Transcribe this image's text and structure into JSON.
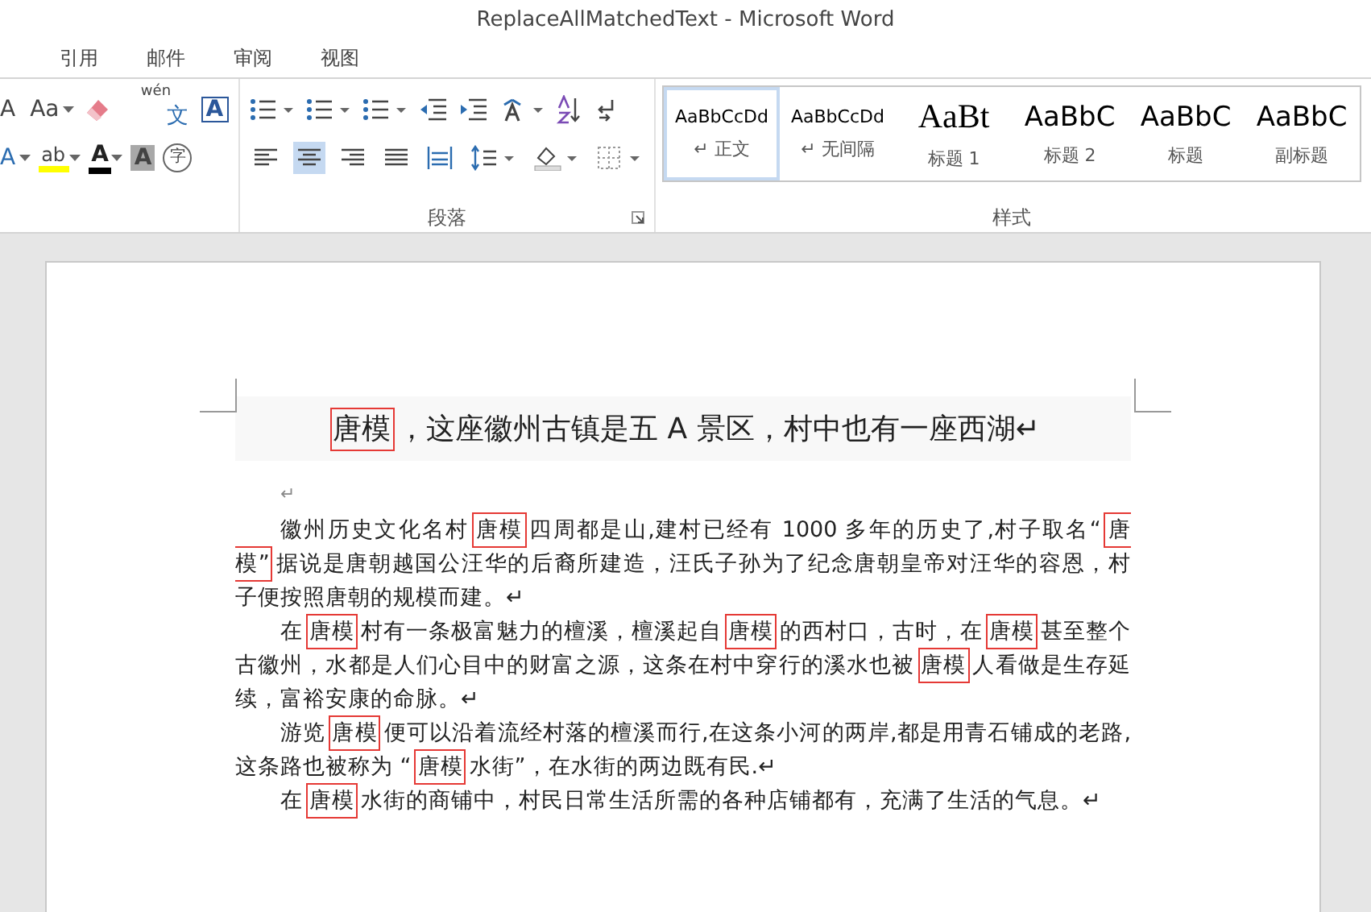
{
  "window": {
    "title": "ReplaceAllMatchedText - Microsoft Word"
  },
  "tabs": [
    {
      "label": "引用",
      "selected": false
    },
    {
      "label": "邮件",
      "selected": false
    },
    {
      "label": "审阅",
      "selected": false
    },
    {
      "label": "视图",
      "selected": false
    }
  ],
  "font_group": {
    "row1": [
      {
        "kind": "grow",
        "glyph": "A"
      },
      {
        "kind": "case",
        "glyph": "Aa"
      },
      {
        "kind": "clear"
      },
      {
        "kind": "phonetic",
        "glyph": "wén",
        "sub": "文"
      },
      {
        "kind": "border",
        "glyph": "A"
      }
    ],
    "row2": [
      {
        "kind": "effects",
        "glyph": "A"
      },
      {
        "kind": "highlight",
        "glyph": "ab"
      },
      {
        "kind": "color",
        "glyph": "A"
      },
      {
        "kind": "shading",
        "glyph": "A"
      },
      {
        "kind": "enclose",
        "glyph": "字"
      }
    ]
  },
  "paragraph_group": {
    "label": "段落",
    "row1": [
      {
        "kind": "bullets"
      },
      {
        "kind": "numbering"
      },
      {
        "kind": "multilevel"
      },
      {
        "kind": "outdent"
      },
      {
        "kind": "indent"
      },
      {
        "kind": "direction"
      },
      {
        "kind": "sort"
      },
      {
        "kind": "marks"
      }
    ],
    "row2": [
      {
        "kind": "left",
        "selected": false
      },
      {
        "kind": "center",
        "selected": true
      },
      {
        "kind": "right",
        "selected": false
      },
      {
        "kind": "justify",
        "selected": false
      },
      {
        "kind": "distribute",
        "selected": false
      },
      {
        "kind": "spacing",
        "selected": false
      },
      {
        "kind": "fill",
        "selected": false
      },
      {
        "kind": "borders",
        "selected": false
      }
    ]
  },
  "styles_group": {
    "label": "样式",
    "styles": [
      {
        "kind": "normal",
        "sample": "AaBbCcDd",
        "name": "↵ 正文",
        "selected": true
      },
      {
        "kind": "normal",
        "sample": "AaBbCcDd",
        "name": "↵ 无间隔",
        "selected": false
      },
      {
        "kind": "heading1",
        "sample": "AaBt",
        "name": "标题 1",
        "selected": false
      },
      {
        "kind": "heading",
        "sample": "AaBbC",
        "name": "标题 2",
        "selected": false
      },
      {
        "kind": "heading",
        "sample": "AaBbC",
        "name": "标题",
        "selected": false
      },
      {
        "kind": "heading",
        "sample": "AaBbC",
        "name": "副标题",
        "selected": false
      }
    ]
  },
  "document": {
    "paragraphs": [
      {
        "kind": "heading",
        "segments": [
          {
            "text": "唐模",
            "boxed": true
          },
          {
            "text": "，这座徽州古镇是五 A 景区，村中也有一座西湖↵",
            "boxed": false
          }
        ]
      },
      {
        "kind": "empty",
        "segments": [
          {
            "text": "↵",
            "boxed": false
          }
        ]
      },
      {
        "kind": "body",
        "segments": [
          {
            "text": "徽州历史文化名村",
            "boxed": false
          },
          {
            "text": "唐模",
            "boxed": true
          },
          {
            "text": "四周都是山,建村已经有 1000 多年的历史了,村子取名“",
            "boxed": false
          },
          {
            "text": "唐模”",
            "boxed": true
          },
          {
            "text": "据说是唐朝越国公汪华的后裔所建造，汪氏子孙为了纪念唐朝皇帝对汪华的容恩，村子便按照唐朝的规模而建。↵",
            "boxed": false
          }
        ]
      },
      {
        "kind": "body",
        "segments": [
          {
            "text": "在",
            "boxed": false
          },
          {
            "text": "唐模",
            "boxed": true
          },
          {
            "text": "村有一条极富魅力的檀溪，檀溪起自",
            "boxed": false
          },
          {
            "text": "唐模",
            "boxed": true
          },
          {
            "text": "的西村口，古时，在",
            "boxed": false
          },
          {
            "text": "唐模",
            "boxed": true
          },
          {
            "text": "甚至整个古徽州，水都是人们心目中的财富之源，这条在村中穿行的溪水也被",
            "boxed": false
          },
          {
            "text": "唐模",
            "boxed": true
          },
          {
            "text": "人看做是生存延续，富裕安康的命脉。↵",
            "boxed": false
          }
        ]
      },
      {
        "kind": "body",
        "segments": [
          {
            "text": "游览",
            "boxed": false
          },
          {
            "text": "唐模",
            "boxed": true
          },
          {
            "text": "便可以沿着流经村落的檀溪而行,在这条小河的两岸,都是用青石铺成的老路,这条路也被称为 “",
            "boxed": false
          },
          {
            "text": "唐模",
            "boxed": true
          },
          {
            "text": "水街”，在水街的两边既有民.↵",
            "boxed": false
          }
        ]
      },
      {
        "kind": "body",
        "segments": [
          {
            "text": "在",
            "boxed": false
          },
          {
            "text": "唐模",
            "boxed": true
          },
          {
            "text": "水街的商铺中，村民日常生活所需的各种店铺都有，充满了生活的气息。↵",
            "boxed": false
          }
        ]
      }
    ]
  }
}
